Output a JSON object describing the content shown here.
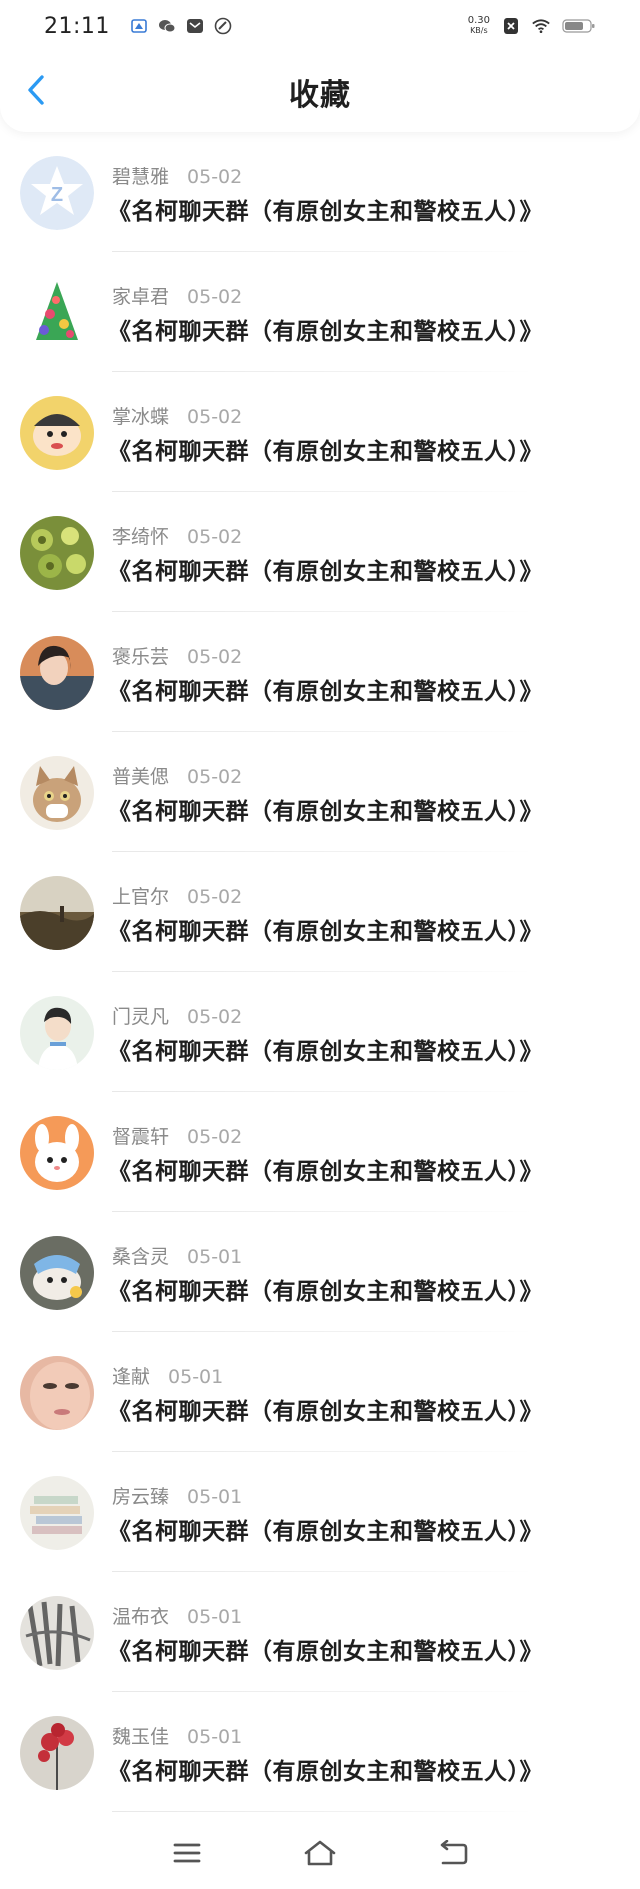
{
  "status_bar": {
    "time": "21:11",
    "net_speed_value": "0.30",
    "net_speed_unit": "KB/s",
    "icons": [
      "notification-app-icon",
      "wechat-icon",
      "message-icon",
      "link-icon",
      "sim-off-icon",
      "wifi-icon",
      "battery-icon"
    ]
  },
  "header": {
    "title": "收藏",
    "back_icon": "chevron-left-icon"
  },
  "colors": {
    "accent": "#2b9af3",
    "title_text": "#1f1f1f",
    "meta_text": "#8a8a8a",
    "date_text": "#a8a8a8"
  },
  "favorites": [
    {
      "name": "碧慧雅",
      "date": "05-02",
      "title": "《名柯聊天群（有原创女主和警校五人）》",
      "avatar": "star-badge-avatar"
    },
    {
      "name": "家卓君",
      "date": "05-02",
      "title": "《名柯聊天群（有原创女主和警校五人）》",
      "avatar": "christmas-tree-avatar"
    },
    {
      "name": "掌冰蝶",
      "date": "05-02",
      "title": "《名柯聊天群（有原创女主和警校五人）》",
      "avatar": "cartoon-boy-avatar"
    },
    {
      "name": "李绮怀",
      "date": "05-02",
      "title": "《名柯聊天群（有原创女主和警校五人）》",
      "avatar": "food-avatar"
    },
    {
      "name": "褒乐芸",
      "date": "05-02",
      "title": "《名柯聊天群（有原创女主和警校五人）》",
      "avatar": "girl-portrait-avatar"
    },
    {
      "name": "普美偲",
      "date": "05-02",
      "title": "《名柯聊天群（有原创女主和警校五人）》",
      "avatar": "cat-avatar"
    },
    {
      "name": "上官尔",
      "date": "05-02",
      "title": "《名柯聊天群（有原创女主和警校五人）》",
      "avatar": "landscape-avatar"
    },
    {
      "name": "门灵凡",
      "date": "05-02",
      "title": "《名柯聊天群（有原创女主和警校五人）》",
      "avatar": "boy-portrait-avatar"
    },
    {
      "name": "督震轩",
      "date": "05-02",
      "title": "《名柯聊天群（有原创女主和警校五人）》",
      "avatar": "cartoon-bunny-avatar"
    },
    {
      "name": "桑含灵",
      "date": "05-01",
      "title": "《名柯聊天群（有原创女主和警校五人）》",
      "avatar": "hamster-avatar"
    },
    {
      "name": "逢献",
      "date": "05-01",
      "title": "《名柯聊天群（有原创女主和警校五人）》",
      "avatar": "face-closeup-avatar"
    },
    {
      "name": "房云臻",
      "date": "05-01",
      "title": "《名柯聊天群（有原创女主和警校五人）》",
      "avatar": "books-avatar"
    },
    {
      "name": "温布衣",
      "date": "05-01",
      "title": "《名柯聊天群（有原创女主和警校五人）》",
      "avatar": "ink-painting-avatar"
    },
    {
      "name": "魏玉佳",
      "date": "05-01",
      "title": "《名柯聊天群（有原创女主和警校五人）》",
      "avatar": "red-flower-avatar"
    }
  ],
  "nav_bar": {
    "buttons": [
      "menu-icon",
      "home-icon",
      "back-icon"
    ]
  }
}
